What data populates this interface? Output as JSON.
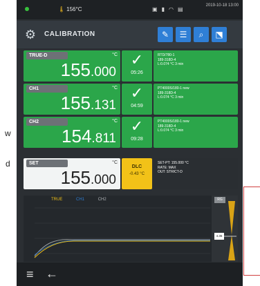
{
  "colors": {
    "ok_green": "#2ba64a",
    "accent_blue": "#2f7fd6",
    "warn_yellow": "#f2c218"
  },
  "background": {
    "letter_w": "w",
    "letter_d": "d"
  },
  "status": {
    "temperature": "156°C",
    "time": "2019-10-18 13:00",
    "icons": [
      "image-icon",
      "battery-icon",
      "wifi-icon",
      "calendar-icon"
    ]
  },
  "header": {
    "title": "CALIBRATION",
    "tools": [
      {
        "icon": "pencil-icon",
        "glyph": "✎"
      },
      {
        "icon": "list-icon",
        "glyph": "☰"
      },
      {
        "icon": "search-icon",
        "glyph": "⌕"
      },
      {
        "icon": "chart-icon",
        "glyph": "⬔"
      }
    ]
  },
  "rows": [
    {
      "label": "TRUE-D",
      "unit": "°C",
      "value_main": "155",
      "value_dec": ".000",
      "time": "05:26",
      "status": "ok",
      "info": [
        "RTD/780-1",
        "189-318D-4",
        "L:0.074 °C 3 min"
      ]
    },
    {
      "label": "CH1",
      "unit": "°C",
      "value_main": "155",
      "value_dec": ".131",
      "time": "04:59",
      "status": "ok",
      "info": [
        "PT4000S/180-1 new",
        "189-318D-4",
        "L:0.074 °C 3 min"
      ]
    },
    {
      "label": "CH2",
      "unit": "°C",
      "value_main": "154",
      "value_dec": ".811",
      "time": "09:28",
      "status": "ok",
      "info": [
        "PT4000S/180-1 new",
        "189-318D-4",
        "L:0.074 °C 3 min"
      ]
    },
    {
      "label": "SET",
      "unit": "°C",
      "value_main": "155",
      "value_dec": ".000",
      "time": "",
      "status": "dlc",
      "badge": "DLC",
      "badge_sub": "-0.43 °C",
      "info": [
        "SET-PT: 155.000 °C",
        "RATE: MAX",
        "OUT: STRICT-D"
      ]
    }
  ],
  "chart": {
    "legend": [
      {
        "name": "TRUE",
        "color": "#f2c218"
      },
      {
        "name": "CH1",
        "color": "#2f7fd6"
      },
      {
        "name": "CH2",
        "color": "#b0b4b8"
      }
    ],
    "yticks": [
      "",
      "",
      "",
      ""
    ],
    "side_label": "RG",
    "side_value": "4.36"
  },
  "bottom": {
    "menu_icon": "≡",
    "back_icon": "←"
  }
}
